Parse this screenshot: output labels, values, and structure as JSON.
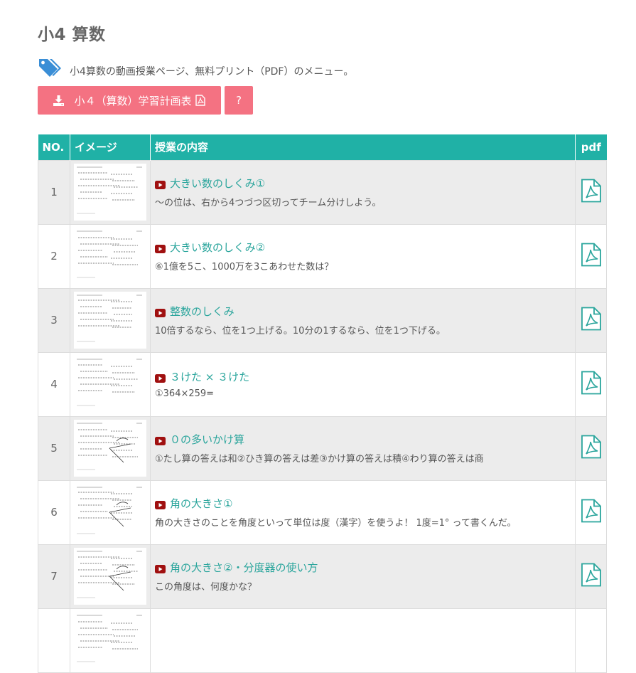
{
  "page": {
    "title": "小4 算数",
    "description": "小4算数の動画授業ページ、無料プリント（PDF）のメニュー。",
    "plan_button": "小４（算数）学習計画表",
    "help_button": "?"
  },
  "table": {
    "headers": [
      "NO.",
      "イメージ",
      "授業の内容",
      "pdf"
    ],
    "rows": [
      {
        "no": "1",
        "title": "大きい数のしくみ①",
        "desc": "〜の位は、右から4つづつ区切ってチーム分けしよう。"
      },
      {
        "no": "2",
        "title": "大きい数のしくみ②",
        "desc": "⑥1億を5こ、1000万を3こあわせた数は？"
      },
      {
        "no": "3",
        "title": "整数のしくみ",
        "desc": "10倍するなら、位を1つ上げる。10分の1するなら、位を1つ下げる。"
      },
      {
        "no": "4",
        "title": "３けた × ３けた",
        "desc": "①364×259="
      },
      {
        "no": "5",
        "title": "０の多いかけ算",
        "desc": "①たし算の答えは和②ひき算の答えは差③かけ算の答えは積④わり算の答えは商"
      },
      {
        "no": "6",
        "title": "角の大きさ①",
        "desc": "角の大きさのことを角度といって単位は度（漢字）を使うよ！ 1度=1° って書くんだ。"
      },
      {
        "no": "7",
        "title": "角の大きさ②・分度器の使い方",
        "desc": "この角度は、何度かな？"
      },
      {
        "no": "",
        "title": "",
        "desc": ""
      }
    ]
  },
  "colors": {
    "header_bg": "#20b1a6",
    "button_bg": "#f47282",
    "link": "#2aa59c",
    "youtube_red": "#a01010",
    "row_alt": "#ececec",
    "tag_icon": "#3a8ed6"
  },
  "icons": {
    "tag": "tags-icon",
    "download": "download-icon",
    "pdf": "pdf-file-icon",
    "video": "youtube-play-icon"
  }
}
